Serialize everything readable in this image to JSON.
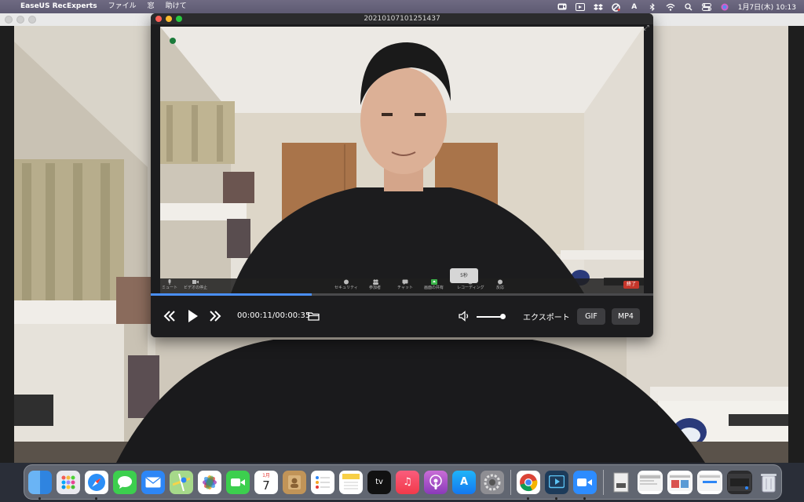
{
  "menubar": {
    "apple": "",
    "app_name": "EaseUS RecExperts",
    "menus": [
      "ファイル",
      "窓",
      "助けて"
    ],
    "clock": "1月7日(木)  10:13"
  },
  "player": {
    "title": "20210107101251437",
    "timecode": "00:00:11/00:00:35",
    "progress_fraction": 0.32,
    "volume_fraction": 0.9,
    "export_label": "エクスポート",
    "gif_label": "GIF",
    "mp4_label": "MP4",
    "zoom_toolbar": {
      "mute": "ミュート",
      "video_stop": "ビデオの停止",
      "security": "セキュリティ",
      "participants": "参加者",
      "chat": "チャット",
      "share": "画面の共有",
      "record": "レコーディング",
      "reactions": "反応",
      "end": "終了",
      "tooltip": "5秒"
    }
  },
  "dock": {
    "apps": [
      "Finder",
      "Launchpad",
      "Safari",
      "Messages",
      "Mail",
      "Maps",
      "Photos",
      "FaceTime",
      "Calendar",
      "Contacts",
      "Reminders",
      "Notes",
      "TV",
      "Music",
      "Podcasts",
      "App Store",
      "System Preferences",
      "Chrome",
      "RecExperts",
      "Zoom"
    ],
    "calendar_month": "1月",
    "calendar_day": "7"
  },
  "colors": {
    "accent": "#4a8ff7",
    "record_red": "#c5362b",
    "menubar": "#625e76"
  }
}
